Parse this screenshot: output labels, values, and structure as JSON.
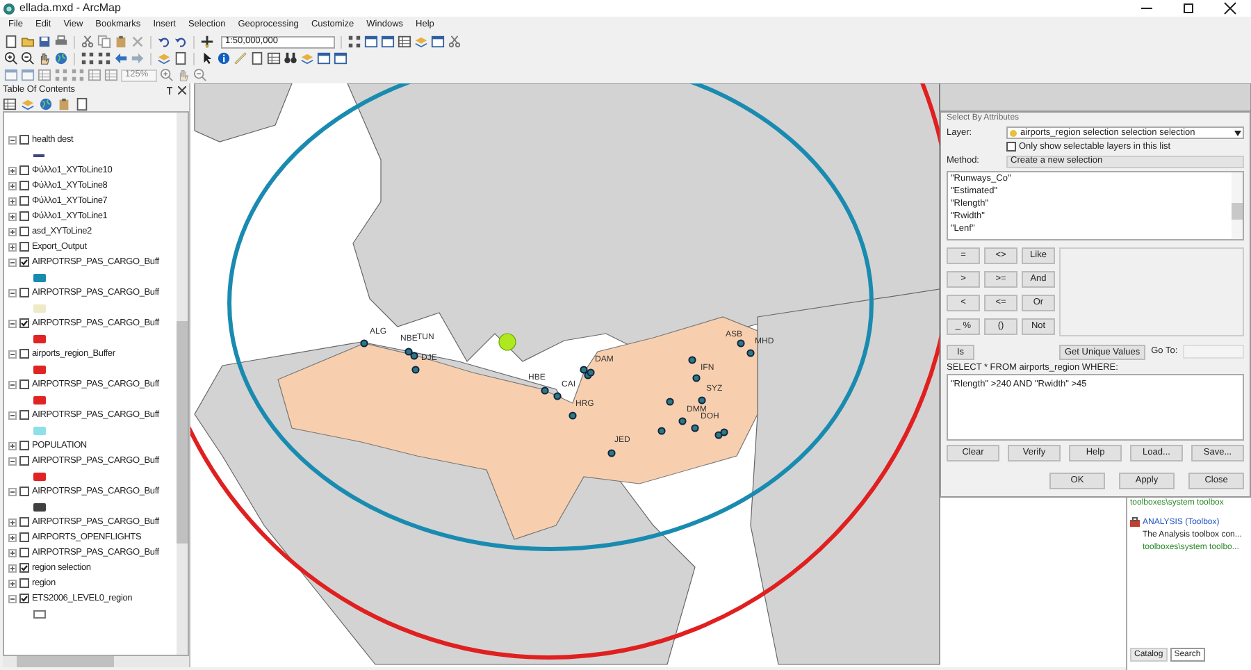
{
  "window": {
    "title": "ellada.mxd - ArcMap"
  },
  "menu": [
    "File",
    "Edit",
    "View",
    "Bookmarks",
    "Insert",
    "Selection",
    "Geoprocessing",
    "Customize",
    "Windows",
    "Help"
  ],
  "toolbar": {
    "scale": "1:50,000,000",
    "zoom": "125%"
  },
  "toc": {
    "title": "Table Of Contents",
    "layers": [
      {
        "name": "health dest",
        "checked": false,
        "expanded": true,
        "symbol": {
          "kind": "line"
        }
      },
      {
        "name": "Φύλλο1_XYToLine10",
        "checked": false,
        "expanded": false
      },
      {
        "name": "Φύλλο1_XYToLine8",
        "checked": false,
        "expanded": false
      },
      {
        "name": "Φύλλο1_XYToLine7",
        "checked": false,
        "expanded": false
      },
      {
        "name": "Φύλλο1_XYToLine1",
        "checked": false,
        "expanded": false
      },
      {
        "name": "asd_XYToLine2",
        "checked": false,
        "expanded": false
      },
      {
        "name": "Export_Output",
        "checked": false,
        "expanded": false
      },
      {
        "name": "AIRPOTRSP_PAS_CARGO_Buff",
        "checked": true,
        "expanded": true,
        "symbol": {
          "kind": "fill",
          "color": "#1a8bb0"
        }
      },
      {
        "name": "AIRPOTRSP_PAS_CARGO_Buff",
        "checked": false,
        "expanded": true,
        "symbol": {
          "kind": "fill",
          "color": "#eeeac8"
        }
      },
      {
        "name": "AIRPOTRSP_PAS_CARGO_Buff",
        "checked": true,
        "expanded": true,
        "symbol": {
          "kind": "fill",
          "color": "#e02424"
        }
      },
      {
        "name": "airports_region_Buffer",
        "checked": false,
        "expanded": true,
        "symbol": {
          "kind": "fill",
          "color": "#e02424"
        }
      },
      {
        "name": "AIRPOTRSP_PAS_CARGO_Buff",
        "checked": false,
        "expanded": true,
        "symbol": {
          "kind": "fill",
          "color": "#e02424"
        }
      },
      {
        "name": "AIRPOTRSP_PAS_CARGO_Buff",
        "checked": false,
        "expanded": true,
        "symbol": {
          "kind": "fill",
          "color": "#8ee0e8"
        }
      },
      {
        "name": "POPULATION",
        "checked": false,
        "expanded": false
      },
      {
        "name": "AIRPOTRSP_PAS_CARGO_Buff",
        "checked": false,
        "expanded": true,
        "symbol": {
          "kind": "fill",
          "color": "#e02424"
        }
      },
      {
        "name": "AIRPOTRSP_PAS_CARGO_Buff",
        "checked": false,
        "expanded": true,
        "symbol": {
          "kind": "fill",
          "color": "#404040"
        }
      },
      {
        "name": "AIRPOTRSP_PAS_CARGO_Buff",
        "checked": false,
        "expanded": false
      },
      {
        "name": "AIRPORTS_OPENFLIGHTS",
        "checked": false,
        "expanded": false
      },
      {
        "name": "AIRPOTRSP_PAS_CARGO_Buff",
        "checked": false,
        "expanded": false
      },
      {
        "name": "region selection",
        "checked": true,
        "expanded": false
      },
      {
        "name": "region",
        "checked": false,
        "expanded": false
      },
      {
        "name": "ETS2006_LEVEL0_region",
        "checked": true,
        "expanded": true,
        "symbol": {
          "kind": "outline"
        }
      }
    ]
  },
  "map": {
    "airports": [
      "ALG",
      "NBE",
      "TUN",
      "DJE",
      "HBE",
      "CAI",
      "DAM",
      "HRG",
      "JED",
      "ASB",
      "MHD",
      "IFN",
      "SYZ",
      "DMM",
      "DOH"
    ]
  },
  "dialog": {
    "title": "Select By Attributes",
    "layer_label": "Layer:",
    "layer": "airports_region selection selection selection",
    "only_selectable": {
      "label": "Only show selectable layers in this list",
      "checked": false
    },
    "method_label": "Method:",
    "method": "Create a new selection",
    "fields": [
      "\"Runways_Co\"",
      "\"Estimated\"",
      "\"Rlength\"",
      "\"Rwidth\"",
      "\"Lenf\""
    ],
    "operators": [
      "=",
      "<>",
      "Like",
      ">",
      ">=",
      "And",
      "<",
      "<=",
      "Or",
      "_ %",
      "()",
      "Not"
    ],
    "is_button": "Is",
    "unique_button": "Get Unique Values",
    "goto_label": "Go To:",
    "query_label": "SELECT * FROM airports_region WHERE:",
    "expression": "\"Rlength\" >240 AND \"Rwidth\" >45",
    "buttons": [
      "Clear",
      "Verify",
      "Help",
      "Load...",
      "Save..."
    ],
    "footer_buttons": [
      "OK",
      "Apply",
      "Close"
    ]
  },
  "results": {
    "lines": [
      "toolboxes\\system toolbox"
    ],
    "item_title": "ANALYSIS (Toolbox)",
    "item_lines": [
      "The Analysis toolbox con...",
      "toolboxes\\system toolbo..."
    ],
    "tabs": [
      {
        "label": "Catalog",
        "selected": false
      },
      {
        "label": "Search",
        "selected": true
      }
    ]
  }
}
